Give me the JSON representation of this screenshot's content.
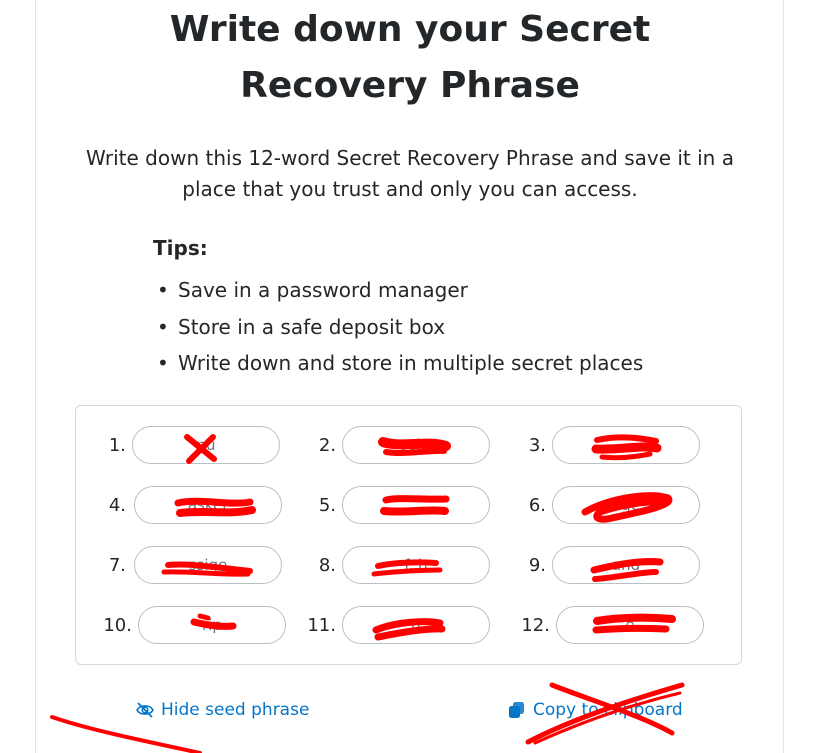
{
  "header": {
    "title_line1": "Write down your Secret",
    "title_line2": "Recovery Phrase"
  },
  "description": {
    "line1": "Write down this 12-word Secret Recovery Phrase and save it in a",
    "line2": "place that you trust and only you can access."
  },
  "tips": {
    "heading": "Tips:",
    "items": [
      "Save in a password manager",
      "Store in a safe deposit box",
      "Write down and store in multiple secret places"
    ]
  },
  "phrase": {
    "words": [
      {
        "number": "1.",
        "word": "pu"
      },
      {
        "number": "2.",
        "word": "ocke"
      },
      {
        "number": "3.",
        "word": ""
      },
      {
        "number": "4.",
        "word": "asket"
      },
      {
        "number": "5.",
        "word": ""
      },
      {
        "number": "6.",
        "word": "age"
      },
      {
        "number": "7.",
        "word": "ssige"
      },
      {
        "number": "8.",
        "word": "f..h"
      },
      {
        "number": "9.",
        "word": "and"
      },
      {
        "number": "10.",
        "word": "rip"
      },
      {
        "number": "11.",
        "word": "d"
      },
      {
        "number": "12.",
        "word": "e"
      }
    ]
  },
  "actions": {
    "hide_label": "Hide seed phrase",
    "copy_label": "Copy to clipboard"
  },
  "colors": {
    "link": "#0376c9",
    "redaction": "#ff0000",
    "text": "#24272a"
  },
  "icons": {
    "hide": "eye-slash-icon",
    "copy": "copy-icon"
  }
}
